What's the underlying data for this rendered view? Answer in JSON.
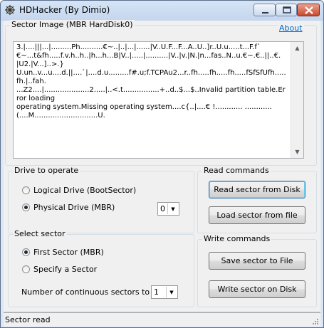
{
  "window": {
    "title": "HDHacker (By Dimio)"
  },
  "sector_image": {
    "legend": "Sector Image (MBR HardDisk0)",
    "about_link": "About",
    "content": "3.|....|||...|.........Ph..........€~..|..|...|......|V..U.F...F...A..U..]r..U.u.....t...F.f`\n€~...t&fh.....f.v.h..h..|h...h...B|V..|.....|..........|V..|v.|N.|n...fas..N..u.€~.€..||..€.\n|U2.|V...]..>.}\nU.un..v...u....d.||....`|....d.u.........f#.u;f.TCPAu2...r..fh.....fh.....fh.....fSfSfUfh.....fh.|..fah.\n...Z2....|....................2.....|..<.t................+..d..$...$..Invalid partition table.Error loading\noperating system.Missing operating system....c{..|....€ !............ ............\n(....M............................U."
  },
  "drive": {
    "legend": "Drive to operate",
    "options": [
      {
        "label": "Logical Drive (BootSector)",
        "selected": false
      },
      {
        "label": "Physical Drive (MBR)",
        "selected": true
      }
    ],
    "disk_number": "0"
  },
  "read_commands": {
    "legend": "Read commands",
    "read_disk": "Read sector from Disk",
    "load_file": "Load sector from file"
  },
  "select_sector": {
    "legend": "Select sector",
    "options": [
      {
        "label": "First Sector (MBR)",
        "selected": true
      },
      {
        "label": "Specify a Sector",
        "selected": false
      }
    ],
    "count_label": "Number of continuous sectors to read",
    "count_value": "1"
  },
  "write_commands": {
    "legend": "Write commands",
    "save_file": "Save sector to File",
    "write_disk": "Write sector on Disk"
  },
  "status": {
    "text": "Sector read"
  }
}
